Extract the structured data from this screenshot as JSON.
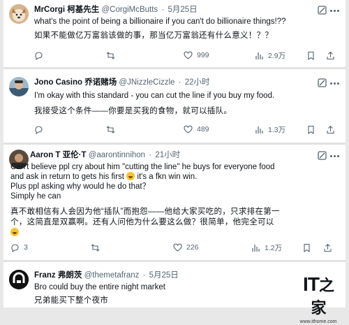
{
  "icons": {
    "reply": "reply-icon",
    "retweet": "retweet-icon",
    "like": "heart-icon",
    "views": "views-icon",
    "grok": "grok-icon",
    "more": "more-icon"
  },
  "tweets": [
    {
      "name": "MrCorgi 柯基先生",
      "handle": "@CorgiMcButts",
      "time": "5月25日",
      "text_en": "what's the point of being a billionaire if you can't do billionaire things!??",
      "text_zh": "如果不能做亿万富翁该做的事，那当亿万富翁还有什么意义！？？",
      "replies": "",
      "retweets": "",
      "likes": "999",
      "views": "2.9万"
    },
    {
      "name": "Jono Casino 乔诺赌场",
      "handle": "@JNizzleCizzle",
      "time": "22小时",
      "text_en": "I'm okay with this standard - you can cut the line if you buy my food.",
      "text_zh": "我接受这个条件——你要是买我的食物，就可以插队。",
      "replies": "",
      "retweets": "",
      "likes": "489",
      "views": "1.3万"
    },
    {
      "name": "Aaron T 亚伦·T",
      "handle": "@aarontinnihon",
      "time": "21小时",
      "text_en_1": "Can't believe ppl cry about him \"cutting the line\" he buys for everyone food",
      "text_en_2": "and ask in return to gets his first",
      "text_en_3": "it's a fkn win win.",
      "text_en_4": "Plus ppl asking why would he do that？",
      "text_en_5": "Simply he can",
      "text_zh_1": "真不敢相信有人会因为他“插队”而抱怨——他给大家买吃的，只求排在第一",
      "text_zh_2": "个，这简直是双赢啊。还有人问他为什么要这么做？很简单，他完全可以",
      "replies": "3",
      "retweets": "",
      "likes": "226",
      "views": "1.2万"
    },
    {
      "name": "Franz 弗朗茨",
      "handle": "@themetafranz",
      "time": "5月25日",
      "text_en": "Bro could buy the entire night market",
      "text_zh": "兄弟能买下整个夜市"
    }
  ],
  "watermark": {
    "brand_latin": "IT",
    "brand_zh": "之家",
    "url": "www.ithome.com"
  }
}
